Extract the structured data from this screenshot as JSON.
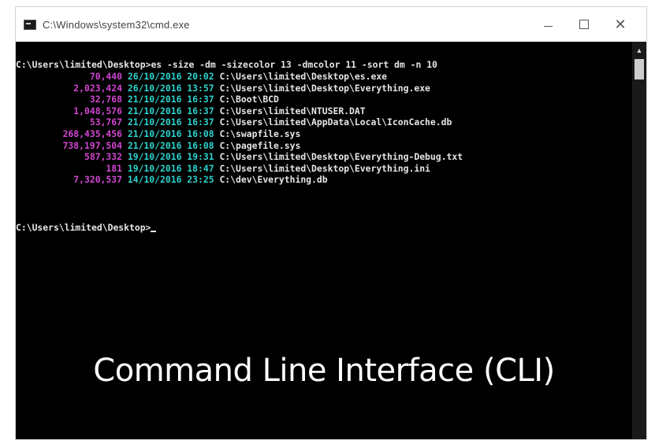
{
  "window": {
    "title": "C:\\Windows\\system32\\cmd.exe",
    "minimize_label": "—",
    "maximize_label": "☐",
    "close_label": "✕"
  },
  "console": {
    "command_line": "C:\\Users\\limited\\Desktop>es -size -dm -sizecolor 13 -dmcolor 11 -sort dm -n 10",
    "rows": [
      {
        "size": "70,440",
        "date": "26/10/2016 20:02",
        "path": "C:\\Users\\limited\\Desktop\\es.exe"
      },
      {
        "size": "2,023,424",
        "date": "26/10/2016 13:57",
        "path": "C:\\Users\\limited\\Desktop\\Everything.exe"
      },
      {
        "size": "32,768",
        "date": "21/10/2016 16:37",
        "path": "C:\\Boot\\BCD"
      },
      {
        "size": "1,048,576",
        "date": "21/10/2016 16:37",
        "path": "C:\\Users\\limited\\NTUSER.DAT"
      },
      {
        "size": "53,767",
        "date": "21/10/2016 16:37",
        "path": "C:\\Users\\limited\\AppData\\Local\\IconCache.db"
      },
      {
        "size": "268,435,456",
        "date": "21/10/2016 16:08",
        "path": "C:\\swapfile.sys"
      },
      {
        "size": "738,197,504",
        "date": "21/10/2016 16:08",
        "path": "C:\\pagefile.sys"
      },
      {
        "size": "587,332",
        "date": "19/10/2016 19:31",
        "path": "C:\\Users\\limited\\Desktop\\Everything-Debug.txt"
      },
      {
        "size": "181",
        "date": "19/10/2016 18:47",
        "path": "C:\\Users\\limited\\Desktop\\Everything.ini"
      },
      {
        "size": "7,320,537",
        "date": "14/10/2016 23:25",
        "path": "C:\\dev\\Everything.db"
      }
    ],
    "prompt": "C:\\Users\\limited\\Desktop>"
  },
  "caption": "Command Line Interface (CLI)",
  "colors": {
    "size": "#d246d2",
    "date": "#2ed3cd",
    "text": "#e6e6e6",
    "background": "#000000"
  },
  "icons": {
    "app": "console-app-icon",
    "minimize": "minimize-icon",
    "maximize": "maximize-icon",
    "close": "close-icon",
    "scroll_up": "scroll-up-arrow-icon"
  }
}
